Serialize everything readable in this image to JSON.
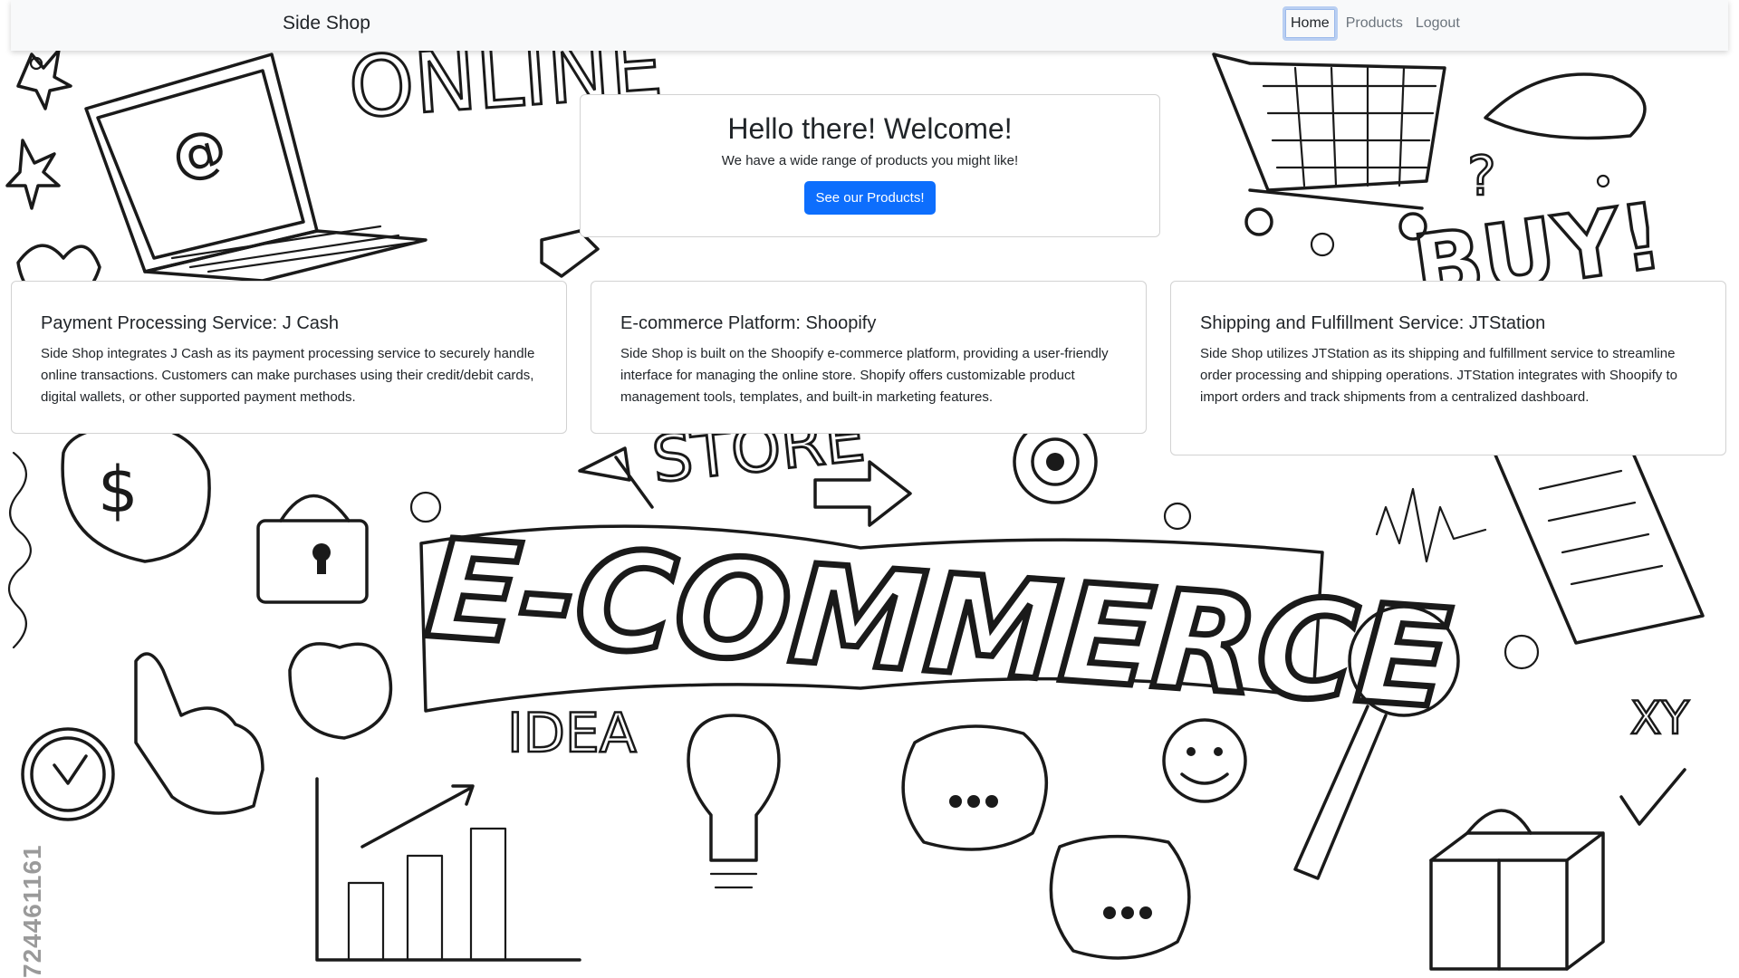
{
  "navbar": {
    "brand": "Side Shop",
    "links": [
      {
        "label": "Home",
        "active": true
      },
      {
        "label": "Products",
        "active": false
      },
      {
        "label": "Logout",
        "active": false
      }
    ]
  },
  "hero": {
    "title": "Hello there! Welcome!",
    "subtitle": "We have a wide range of products you might like!",
    "button_label": "See our Products!"
  },
  "cards": [
    {
      "title": "Payment Processing Service: J Cash",
      "text": "Side Shop integrates J Cash as its payment processing service to securely handle online transactions. Customers can make purchases using their credit/debit cards, digital wallets, or other supported payment methods."
    },
    {
      "title": "E-commerce Platform: Shoopify",
      "text": "Side Shop is built on the Shoopify e-commerce platform, providing a user-friendly interface for managing the online store. Shopify offers customizable product management tools, templates, and built-in marketing features."
    },
    {
      "title": "Shipping and Fulfillment Service: JTStation",
      "text": "Side Shop utilizes JTStation as its shipping and fulfillment service to streamline order processing and shipping operations. JTStation integrates with Shoopify to import orders and track shipments from a centralized dashboard."
    }
  ],
  "background": {
    "words": [
      "ONLINE",
      "STORE",
      "IDEA",
      "E-COMMERCE",
      "$",
      "XY"
    ],
    "watermark_id": "724461161"
  },
  "colors": {
    "navbar_bg": "#f8f9fa",
    "primary": "#0d6efd",
    "text": "#212529",
    "muted": "#6c757d"
  }
}
